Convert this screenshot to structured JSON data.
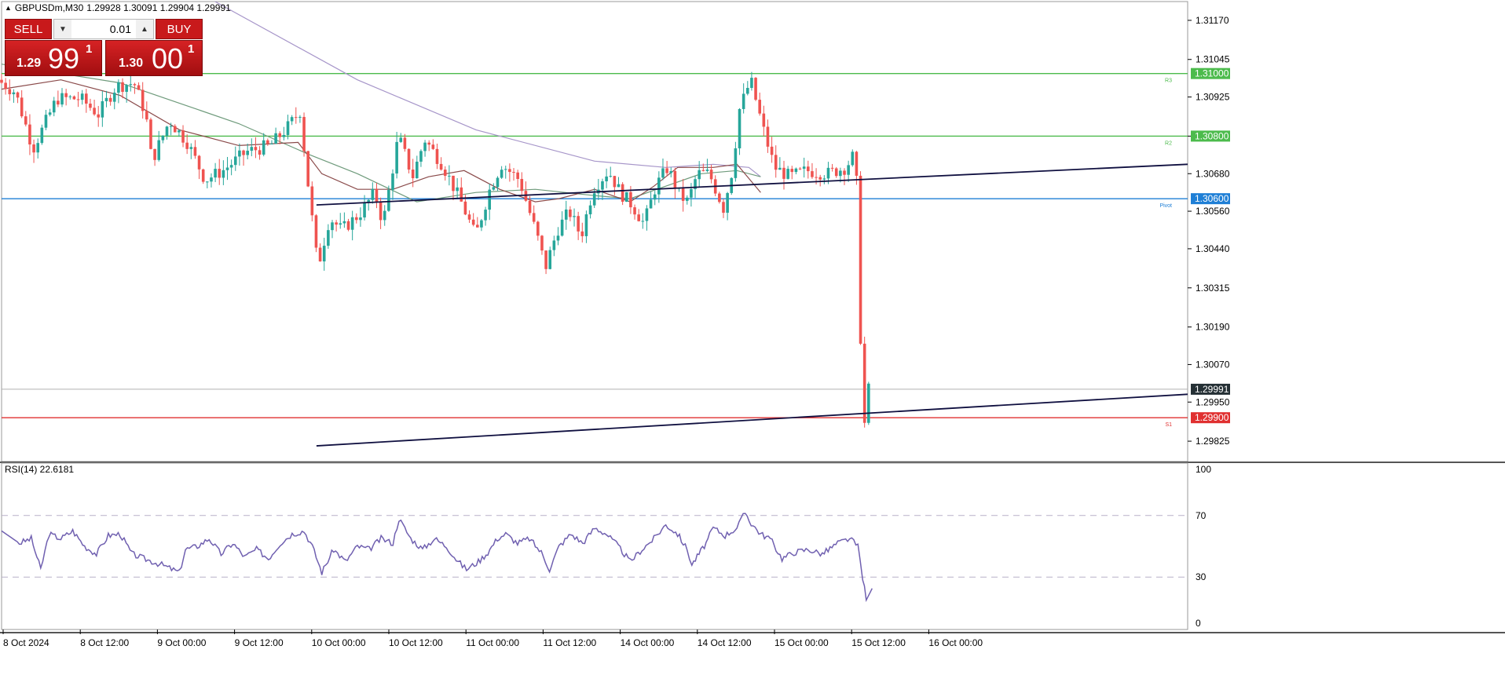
{
  "header": {
    "symbol_timeframe": "GBPUSDm,M30",
    "ohlc": "1.29928 1.30091 1.29904 1.29991"
  },
  "trade_panel": {
    "sell_label": "SELL",
    "buy_label": "BUY",
    "lot_value": "0.01",
    "sell_price": {
      "small": "1.29",
      "big": "99",
      "sup": "1"
    },
    "buy_price": {
      "small": "1.30",
      "big": "00",
      "sup": "1"
    }
  },
  "rsi_label": "RSI(14) 22.6181",
  "colors": {
    "bull": "#26a69a",
    "bear": "#ef5350",
    "resistance": "#4cbb4c",
    "pivot": "#1f7fd6",
    "support": "#e03030",
    "trendline": "#101040",
    "rsi": "#7060b0"
  },
  "chart_data": [
    {
      "type": "candlestick",
      "symbol": "GBPUSDm",
      "timeframe": "M30",
      "ylim": [
        1.2976,
        1.3123
      ],
      "y_ticks": [
        "1.31170",
        "1.31045",
        "1.30925",
        "1.30800",
        "1.30680",
        "1.30560",
        "1.30440",
        "1.30315",
        "1.30190",
        "1.30070",
        "1.29950",
        "1.29825"
      ],
      "x_ticks": [
        "8 Oct 2024",
        "8 Oct 12:00",
        "9 Oct 00:00",
        "9 Oct 12:00",
        "10 Oct 00:00",
        "10 Oct 12:00",
        "11 Oct 00:00",
        "11 Oct 12:00",
        "14 Oct 00:00",
        "14 Oct 12:00",
        "15 Oct 00:00",
        "15 Oct 12:00",
        "16 Oct 00:00"
      ],
      "levels": [
        {
          "price": 1.31,
          "label": "1.31000",
          "tag": "R3",
          "kind": "resistance"
        },
        {
          "price": 1.308,
          "label": "1.30800",
          "tag": "R2",
          "kind": "resistance"
        },
        {
          "price": 1.306,
          "label": "1.30600",
          "tag": "Pivot",
          "kind": "pivot"
        },
        {
          "price": 1.299,
          "label": "1.29900",
          "tag": "S1",
          "kind": "support"
        }
      ],
      "current_price": {
        "price": 1.29991,
        "label": "1.29991"
      },
      "trendlines": [
        {
          "from": [
            0.2655,
            1.3058
          ],
          "to": [
            1.0,
            1.3071
          ]
        },
        {
          "from": [
            0.2655,
            1.2981
          ],
          "to": [
            1.0,
            1.29975
          ]
        }
      ],
      "moving_averages": [
        {
          "color": "#a695c9",
          "points": [
            [
              0.18,
              1.3123
            ],
            [
              0.3,
              1.3098
            ],
            [
              0.4,
              1.3082
            ],
            [
              0.5,
              1.3072
            ],
            [
              0.56,
              1.307
            ],
            [
              0.6,
              1.3071
            ],
            [
              0.63,
              1.307
            ],
            [
              0.64,
              1.3067
            ]
          ]
        },
        {
          "color": "#6f9b7c",
          "points": [
            [
              0.0,
              1.3103
            ],
            [
              0.1,
              1.3097
            ],
            [
              0.2,
              1.3084
            ],
            [
              0.26,
              1.3074
            ],
            [
              0.3,
              1.3068
            ],
            [
              0.35,
              1.3059
            ],
            [
              0.4,
              1.3062
            ],
            [
              0.45,
              1.3063
            ],
            [
              0.5,
              1.3061
            ],
            [
              0.53,
              1.306
            ],
            [
              0.56,
              1.3064
            ],
            [
              0.59,
              1.3068
            ],
            [
              0.62,
              1.3069
            ],
            [
              0.64,
              1.3067
            ]
          ]
        },
        {
          "color": "#8a4a4a",
          "points": [
            [
              0.0,
              1.3095
            ],
            [
              0.05,
              1.3098
            ],
            [
              0.1,
              1.3093
            ],
            [
              0.15,
              1.3082
            ],
            [
              0.2,
              1.3077
            ],
            [
              0.25,
              1.3078
            ],
            [
              0.27,
              1.3068
            ],
            [
              0.3,
              1.3063
            ],
            [
              0.33,
              1.3063
            ],
            [
              0.36,
              1.3067
            ],
            [
              0.39,
              1.3069
            ],
            [
              0.42,
              1.3063
            ],
            [
              0.45,
              1.3059
            ],
            [
              0.47,
              1.306
            ],
            [
              0.5,
              1.3063
            ],
            [
              0.53,
              1.3059
            ],
            [
              0.55,
              1.3064
            ],
            [
              0.57,
              1.307
            ],
            [
              0.6,
              1.307
            ],
            [
              0.62,
              1.3071
            ],
            [
              0.64,
              1.3062
            ]
          ]
        }
      ],
      "candle_waypoints": [
        [
          0.0,
          1.3098
        ],
        [
          0.015,
          1.3094
        ],
        [
          0.03,
          1.3076
        ],
        [
          0.05,
          1.3092
        ],
        [
          0.07,
          1.3092
        ],
        [
          0.085,
          1.3087
        ],
        [
          0.1,
          1.3096
        ],
        [
          0.115,
          1.3097
        ],
        [
          0.125,
          1.3087
        ],
        [
          0.13,
          1.3072
        ],
        [
          0.145,
          1.3085
        ],
        [
          0.16,
          1.3078
        ],
        [
          0.175,
          1.3066
        ],
        [
          0.19,
          1.3069
        ],
        [
          0.21,
          1.3075
        ],
        [
          0.23,
          1.3077
        ],
        [
          0.245,
          1.3083
        ],
        [
          0.255,
          1.3088
        ],
        [
          0.262,
          1.3064
        ],
        [
          0.27,
          1.3038
        ],
        [
          0.28,
          1.3054
        ],
        [
          0.29,
          1.305
        ],
        [
          0.305,
          1.3055
        ],
        [
          0.318,
          1.3062
        ],
        [
          0.325,
          1.3052
        ],
        [
          0.338,
          1.308
        ],
        [
          0.35,
          1.3067
        ],
        [
          0.36,
          1.3079
        ],
        [
          0.375,
          1.3071
        ],
        [
          0.392,
          1.3058
        ],
        [
          0.403,
          1.3048
        ],
        [
          0.415,
          1.3063
        ],
        [
          0.425,
          1.3071
        ],
        [
          0.44,
          1.3066
        ],
        [
          0.455,
          1.3048
        ],
        [
          0.462,
          1.3038
        ],
        [
          0.472,
          1.305
        ],
        [
          0.482,
          1.3056
        ],
        [
          0.492,
          1.3048
        ],
        [
          0.502,
          1.3063
        ],
        [
          0.515,
          1.3069
        ],
        [
          0.525,
          1.3062
        ],
        [
          0.535,
          1.3058
        ],
        [
          0.545,
          1.3052
        ],
        [
          0.555,
          1.3064
        ],
        [
          0.565,
          1.307
        ],
        [
          0.575,
          1.3061
        ],
        [
          0.582,
          1.3059
        ],
        [
          0.59,
          1.3068
        ],
        [
          0.6,
          1.3068
        ],
        [
          0.612,
          1.3057
        ],
        [
          0.62,
          1.307
        ],
        [
          0.625,
          1.3088
        ],
        [
          0.635,
          1.3098
        ],
        [
          0.645,
          1.3083
        ],
        [
          0.655,
          1.307
        ],
        [
          0.668,
          1.3067
        ],
        [
          0.682,
          1.3069
        ],
        [
          0.7,
          1.3068
        ],
        [
          0.715,
          1.307
        ],
        [
          0.722,
          1.3074
        ],
        [
          0.726,
          1.3058
        ],
        [
          0.728,
          1.3005
        ],
        [
          0.729,
          1.2986
        ],
        [
          0.731,
          1.2988
        ],
        [
          0.733,
          1.2999
        ]
      ]
    },
    {
      "type": "line",
      "name": "RSI(14) 22.6181",
      "ylim": [
        0,
        100
      ],
      "y_ticks": [
        "100",
        "70",
        "30",
        "0"
      ],
      "levels": [
        70,
        30
      ],
      "values": [
        [
          0.0,
          60
        ],
        [
          0.015,
          52
        ],
        [
          0.025,
          55
        ],
        [
          0.033,
          35
        ],
        [
          0.04,
          58
        ],
        [
          0.05,
          55
        ],
        [
          0.06,
          60
        ],
        [
          0.07,
          50
        ],
        [
          0.08,
          45
        ],
        [
          0.09,
          57
        ],
        [
          0.1,
          58
        ],
        [
          0.11,
          45
        ],
        [
          0.12,
          42
        ],
        [
          0.135,
          38
        ],
        [
          0.15,
          33
        ],
        [
          0.155,
          48
        ],
        [
          0.165,
          50
        ],
        [
          0.175,
          55
        ],
        [
          0.185,
          45
        ],
        [
          0.195,
          52
        ],
        [
          0.205,
          43
        ],
        [
          0.215,
          48
        ],
        [
          0.225,
          42
        ],
        [
          0.235,
          52
        ],
        [
          0.245,
          58
        ],
        [
          0.255,
          60
        ],
        [
          0.262,
          50
        ],
        [
          0.27,
          33
        ],
        [
          0.28,
          48
        ],
        [
          0.29,
          40
        ],
        [
          0.3,
          50
        ],
        [
          0.31,
          48
        ],
        [
          0.32,
          55
        ],
        [
          0.33,
          52
        ],
        [
          0.335,
          68
        ],
        [
          0.345,
          55
        ],
        [
          0.355,
          48
        ],
        [
          0.365,
          55
        ],
        [
          0.375,
          50
        ],
        [
          0.385,
          40
        ],
        [
          0.392,
          35
        ],
        [
          0.402,
          40
        ],
        [
          0.41,
          46
        ],
        [
          0.418,
          55
        ],
        [
          0.425,
          58
        ],
        [
          0.435,
          52
        ],
        [
          0.445,
          55
        ],
        [
          0.455,
          46
        ],
        [
          0.462,
          35
        ],
        [
          0.47,
          50
        ],
        [
          0.48,
          58
        ],
        [
          0.49,
          52
        ],
        [
          0.5,
          62
        ],
        [
          0.51,
          58
        ],
        [
          0.52,
          50
        ],
        [
          0.53,
          40
        ],
        [
          0.54,
          48
        ],
        [
          0.55,
          55
        ],
        [
          0.56,
          64
        ],
        [
          0.57,
          58
        ],
        [
          0.578,
          48
        ],
        [
          0.582,
          38
        ],
        [
          0.588,
          45
        ],
        [
          0.594,
          52
        ],
        [
          0.6,
          62
        ],
        [
          0.61,
          57
        ],
        [
          0.62,
          62
        ],
        [
          0.627,
          72
        ],
        [
          0.632,
          65
        ],
        [
          0.64,
          58
        ],
        [
          0.648,
          55
        ],
        [
          0.658,
          42
        ],
        [
          0.668,
          46
        ],
        [
          0.68,
          48
        ],
        [
          0.692,
          45
        ],
        [
          0.705,
          52
        ],
        [
          0.715,
          55
        ],
        [
          0.722,
          50
        ],
        [
          0.726,
          30
        ],
        [
          0.729,
          15
        ],
        [
          0.731,
          18
        ],
        [
          0.734,
          22.6
        ]
      ]
    }
  ]
}
